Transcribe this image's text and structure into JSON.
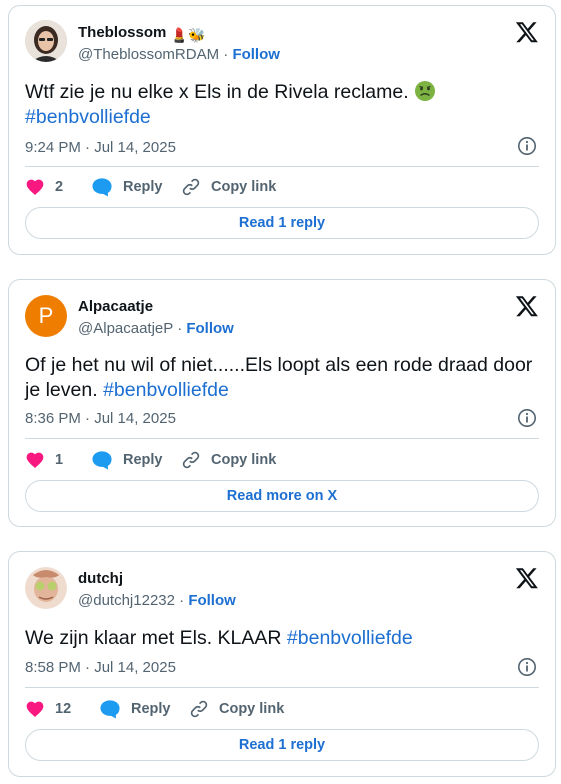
{
  "tweets": [
    {
      "name": "Theblossom",
      "name_emojis": "💄🐝",
      "handle": "@TheblossomRDAM",
      "follow_label": "Follow",
      "dot": "·",
      "text": "Wtf zie je nu elke x Els in de  Rivela reclame.",
      "text_emoji": "🤢",
      "hashtag": "#benbvolliefde",
      "timestamp": "9:24 PM · Jul 14, 2025",
      "likes": "2",
      "reply_label": "Reply",
      "copy_label": "Copy link",
      "footer_button": "Read 1 reply",
      "avatar_icon": "photo-avatar",
      "colors": {
        "avatar_bg": "#c9b8a8"
      }
    },
    {
      "name": "Alpacaatje",
      "handle": "@AlpacaatjeP",
      "follow_label": "Follow",
      "dot": "·",
      "text_line1": "Of je het nu wil of niet......Els loopt als een rode draad door",
      "text_line2": "je leven.",
      "hashtag": "#benbvolliefde",
      "timestamp": "8:36 PM · Jul 14, 2025",
      "likes": "1",
      "reply_label": "Reply",
      "copy_label": "Copy link",
      "footer_button": "Read more on X",
      "avatar_letter": "P",
      "colors": {
        "avatar_bg": "#ef7d00"
      }
    },
    {
      "name": "dutchj",
      "handle": "@dutchj12232",
      "follow_label": "Follow",
      "dot": "·",
      "text": "We zijn klaar met Els. KLAAR",
      "hashtag": "#benbvolliefde",
      "timestamp": "8:58 PM · Jul 14, 2025",
      "likes": "12",
      "reply_label": "Reply",
      "copy_label": "Copy link",
      "footer_button": "Read 1 reply",
      "avatar_icon": "photo-avatar",
      "colors": {
        "avatar_bg": "#e8cfc0"
      }
    }
  ],
  "icons": {
    "logo": "x-logo-icon",
    "info": "info-icon",
    "like": "heart-icon",
    "reply": "speech-bubble-icon",
    "copy": "link-icon"
  },
  "colors": {
    "accent": "#1d6fd1",
    "heart": "#f91880",
    "reply_bubble": "#1d9bf0",
    "muted": "#536471",
    "border": "#cfd9de"
  }
}
